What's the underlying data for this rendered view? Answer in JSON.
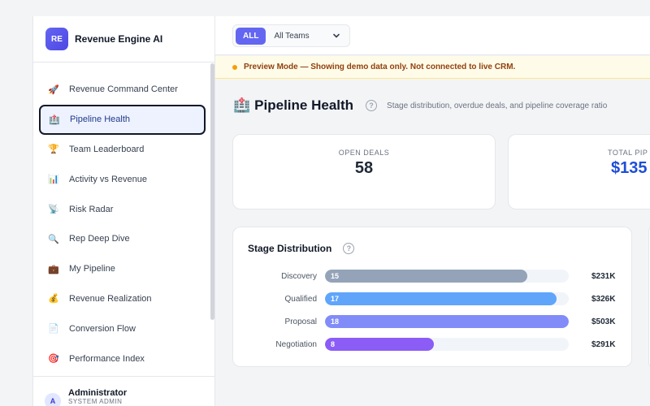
{
  "brand": {
    "initials": "RE",
    "name": "Revenue Engine AI"
  },
  "nav": [
    {
      "label": "Revenue Command Center",
      "icon": "rocket-icon",
      "glyph": "🚀"
    },
    {
      "label": "Pipeline Health",
      "icon": "hospital-icon",
      "glyph": "🏥",
      "active": true
    },
    {
      "label": "Team Leaderboard",
      "icon": "trophy-icon",
      "glyph": "🏆"
    },
    {
      "label": "Activity vs Revenue",
      "icon": "bar-chart-icon",
      "glyph": "📊"
    },
    {
      "label": "Risk Radar",
      "icon": "satellite-dish-icon",
      "glyph": "📡"
    },
    {
      "label": "Rep Deep Dive",
      "icon": "magnifier-icon",
      "glyph": "🔍"
    },
    {
      "label": "My Pipeline",
      "icon": "briefcase-icon",
      "glyph": "💼"
    },
    {
      "label": "Revenue Realization",
      "icon": "money-bag-icon",
      "glyph": "💰"
    },
    {
      "label": "Conversion Flow",
      "icon": "document-icon",
      "glyph": "📄"
    },
    {
      "label": "Performance Index",
      "icon": "target-icon",
      "glyph": "🎯"
    }
  ],
  "user": {
    "initial": "A",
    "name": "Administrator",
    "role": "SYSTEM ADMIN"
  },
  "filters": {
    "all_label": "ALL",
    "team_select": "All Teams"
  },
  "banner": "Preview Mode — Showing demo data only. Not connected to live CRM.",
  "page": {
    "icon": "hospital-icon",
    "title": "Pipeline Health",
    "subtitle": "Stage distribution, overdue deals, and pipeline coverage ratio"
  },
  "stats": [
    {
      "label": "OPEN DEALS",
      "value": "58"
    },
    {
      "label": "TOTAL PIP",
      "value": "$135"
    }
  ],
  "stage_panel": {
    "title": "Stage Distribution",
    "stages": [
      {
        "label": "Discovery",
        "count": "15",
        "amount": "$231K",
        "fill": 0.83,
        "color": "#94a3b8"
      },
      {
        "label": "Qualified",
        "count": "17",
        "amount": "$326K",
        "fill": 0.95,
        "color": "#60a5fa"
      },
      {
        "label": "Proposal",
        "count": "18",
        "amount": "$503K",
        "fill": 1.0,
        "color": "#818cf8"
      },
      {
        "label": "Negotiation",
        "count": "8",
        "amount": "$291K",
        "fill": 0.445,
        "color": "#8b5cf6"
      }
    ]
  },
  "colors": {
    "accent": "#6366f1",
    "banner_bg": "#fefce8",
    "banner_text": "#92400e",
    "blue_value": "#1d4ed8"
  }
}
